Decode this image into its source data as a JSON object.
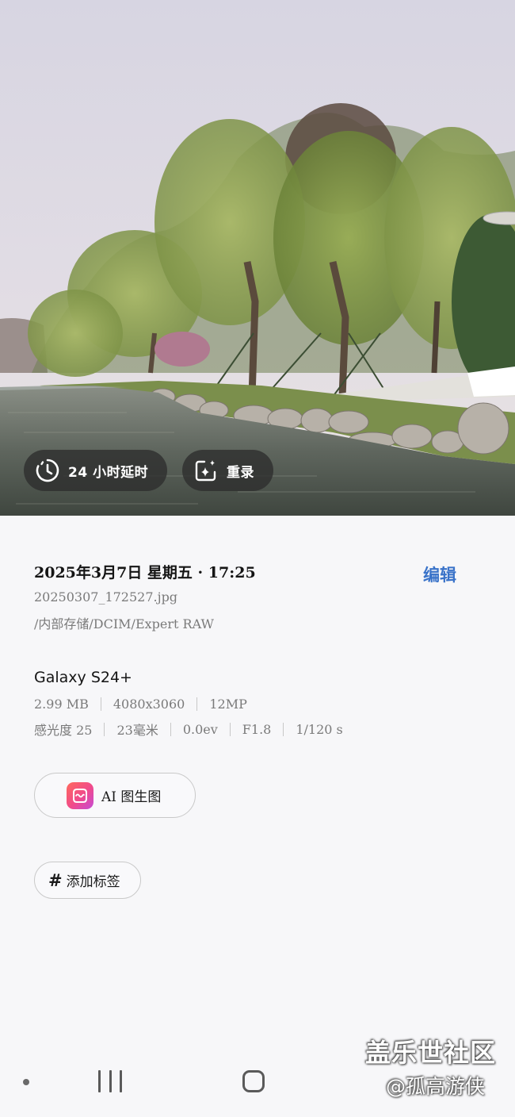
{
  "photo": {
    "alt": ""
  },
  "overlay": {
    "timelapse_label": "24 小时延时",
    "rerecord_label": "重录"
  },
  "info": {
    "datetime": "2025年3月7日 星期五 · 17:25",
    "edit_label": "编辑",
    "filename": "20250307_172527.jpg",
    "path": "/内部存储/DCIM/Expert RAW",
    "device": "Galaxy S24+",
    "specs_row1": [
      "2.99 MB",
      "4080x3060",
      "12MP"
    ],
    "specs_row2": [
      "感光度 25",
      "23毫米",
      "0.0ev",
      "F1.8",
      "1/120 s"
    ]
  },
  "actions": {
    "ai_label": "AI 图生图",
    "tag_hash": "#",
    "tag_label": "添加标签"
  },
  "watermark": {
    "line1": "盖乐世社区",
    "line2": "@孤高游侠"
  },
  "colors": {
    "accent": "#3a73c9",
    "sheet_bg": "#f7f7f9",
    "pill_bg": "#2d2d2d"
  },
  "icons": {
    "timelapse": "timelapse-clock-icon",
    "rerecord": "sparkle-frame-icon",
    "ai_app": "ai-image-app-icon",
    "nav_recents": "recents-icon",
    "nav_home": "home-icon"
  }
}
